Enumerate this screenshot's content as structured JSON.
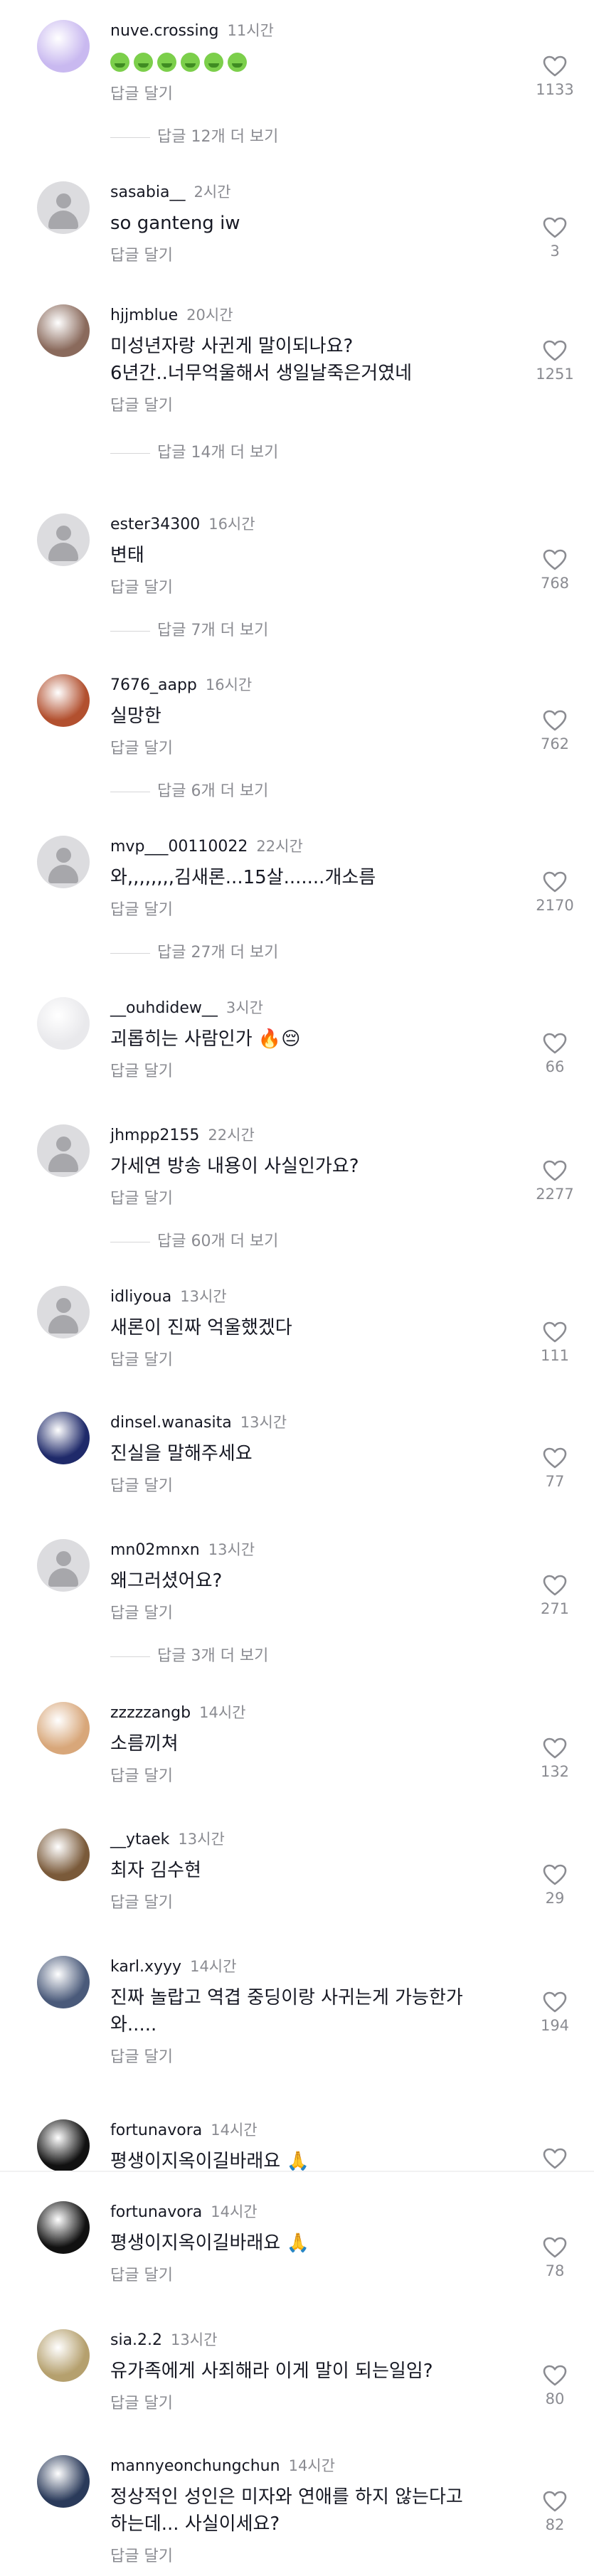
{
  "reply_label": "답글 달기",
  "comments": [
    {
      "user": "nuve.crossing",
      "time": "11시간",
      "text": "",
      "emojis": 6,
      "likes": "1133",
      "more": "답글 12개 더 보기",
      "avatar": "photo",
      "avatar_color": "#c9b9f0"
    },
    {
      "user": "sasabia__",
      "time": "2시간",
      "text": "so ganteng iw",
      "likes": "3",
      "more": "",
      "avatar": "default"
    },
    {
      "user": "hjjmblue",
      "time": "20시간",
      "text": "미성년자랑 사귄게 말이되나요?\n6년간..너무억울해서 생일날죽은거였네",
      "likes": "1251",
      "more": "답글 14개 더 보기",
      "avatar": "photo",
      "avatar_color": "#8a6a5c"
    },
    {
      "user": "ester34300",
      "time": "16시간",
      "text": "변태",
      "likes": "768",
      "more": "답글 7개 더 보기",
      "avatar": "default"
    },
    {
      "user": "7676_aapp",
      "time": "16시간",
      "text": "실망한",
      "likes": "762",
      "more": "답글 6개 더 보기",
      "avatar": "photo",
      "avatar_color": "#b2502f"
    },
    {
      "user": "mvp___00110022",
      "time": "22시간",
      "text": "와,,,,,,,,김새론...15살.......개소름",
      "likes": "2170",
      "more": "답글 27개 더 보기",
      "avatar": "default"
    },
    {
      "user": "__ouhdidew__",
      "time": "3시간",
      "text": "괴롭히는 사람인가 🔥😔",
      "likes": "66",
      "more": "",
      "avatar": "photo",
      "avatar_color": "#e9e9ec"
    },
    {
      "user": "jhmpp2155",
      "time": "22시간",
      "text": "가세연 방송 내용이 사실인가요?",
      "likes": "2277",
      "more": "답글 60개 더 보기",
      "avatar": "default"
    },
    {
      "user": "idliyoua",
      "time": "13시간",
      "text": "새론이 진짜 억울했겠다",
      "likes": "111",
      "more": "",
      "avatar": "default"
    },
    {
      "user": "dinsel.wanasita",
      "time": "13시간",
      "text": "진실을 말해주세요",
      "likes": "77",
      "more": "",
      "avatar": "photo",
      "avatar_color": "#1f2a6a"
    },
    {
      "user": "mn02mnxn",
      "time": "13시간",
      "text": "왜그러셨어요?",
      "likes": "271",
      "more": "답글 3개 더 보기",
      "avatar": "default"
    },
    {
      "user": "zzzzzangb",
      "time": "14시간",
      "text": "소름끼쳐",
      "likes": "132",
      "more": "",
      "avatar": "photo",
      "avatar_color": "#d8a77a"
    },
    {
      "user": "__ytaek",
      "time": "13시간",
      "text": "최자 김수현",
      "likes": "29",
      "more": "",
      "avatar": "photo",
      "avatar_color": "#7a5a3a"
    },
    {
      "user": "karl.xyyy",
      "time": "14시간",
      "text": "진짜 놀랍고 역겹 중딩이랑 사귀는게 가능한가\n와.....",
      "likes": "194",
      "more": "",
      "avatar": "photo",
      "avatar_color": "#4a5a7a"
    },
    {
      "user": "fortunavora",
      "time": "14시간",
      "text": "평생이지옥이길바래요 🙏",
      "likes": "",
      "more": "",
      "avatar": "photo",
      "avatar_color": "#111111"
    },
    {
      "user": "fortunavora",
      "time": "14시간",
      "text": "평생이지옥이길바래요 🙏",
      "likes": "78",
      "more": "",
      "avatar": "photo",
      "avatar_color": "#111111"
    },
    {
      "user": "sia.2.2",
      "time": "13시간",
      "text": "유가족에게 사죄해라 이게 말이 되는일임?",
      "likes": "80",
      "more": "",
      "avatar": "photo",
      "avatar_color": "#b5a06e"
    },
    {
      "user": "mannyeonchungchun",
      "time": "14시간",
      "text": "정상적인 성인은 미자와 연애를 하지 않는다고\n하는데... 사실이세요?",
      "likes": "82",
      "more": "",
      "avatar": "photo",
      "avatar_color": "#2a3a5a"
    }
  ],
  "icons": {
    "like": "heart-outline-icon"
  }
}
